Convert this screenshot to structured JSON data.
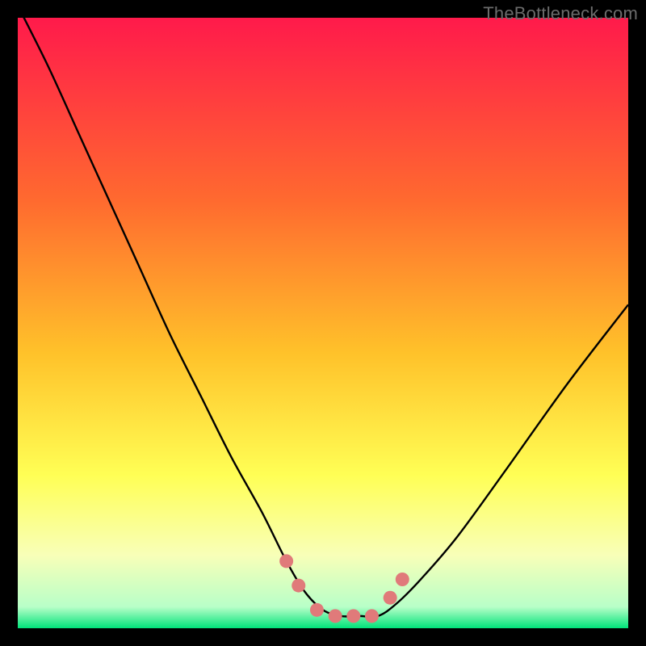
{
  "watermark": "TheBottleneck.com",
  "colors": {
    "bg_black": "#000000",
    "grad_top": "#ff1a4b",
    "grad_mid1": "#ff8a2a",
    "grad_mid2": "#ffd02a",
    "grad_mid3": "#ffff55",
    "grad_low": "#f8ffb8",
    "grad_bottom": "#00e37a",
    "curve": "#000000",
    "marker": "#e07a7a"
  },
  "chart_data": {
    "type": "line",
    "title": "",
    "xlabel": "",
    "ylabel": "",
    "xlim": [
      0,
      100
    ],
    "ylim": [
      0,
      100
    ],
    "series": [
      {
        "name": "bottleneck-curve",
        "x": [
          0,
          5,
          10,
          15,
          20,
          25,
          30,
          35,
          40,
          44,
          47,
          50,
          53,
          56,
          59,
          62,
          66,
          72,
          80,
          90,
          100
        ],
        "y": [
          102,
          92,
          81,
          70,
          59,
          48,
          38,
          28,
          19,
          11,
          6,
          3,
          2,
          2,
          2,
          4,
          8,
          15,
          26,
          40,
          53
        ]
      }
    ],
    "markers": {
      "name": "highlight-points",
      "x": [
        44,
        46,
        49,
        52,
        55,
        58,
        61,
        63
      ],
      "y": [
        11,
        7,
        3,
        2,
        2,
        2,
        5,
        8
      ]
    },
    "gradient_stops": [
      {
        "offset": 0.0,
        "color": "#ff1a4b"
      },
      {
        "offset": 0.3,
        "color": "#ff6a2f"
      },
      {
        "offset": 0.55,
        "color": "#ffc22a"
      },
      {
        "offset": 0.75,
        "color": "#ffff55"
      },
      {
        "offset": 0.88,
        "color": "#f8ffb8"
      },
      {
        "offset": 0.965,
        "color": "#b8ffc8"
      },
      {
        "offset": 1.0,
        "color": "#00e37a"
      }
    ]
  }
}
